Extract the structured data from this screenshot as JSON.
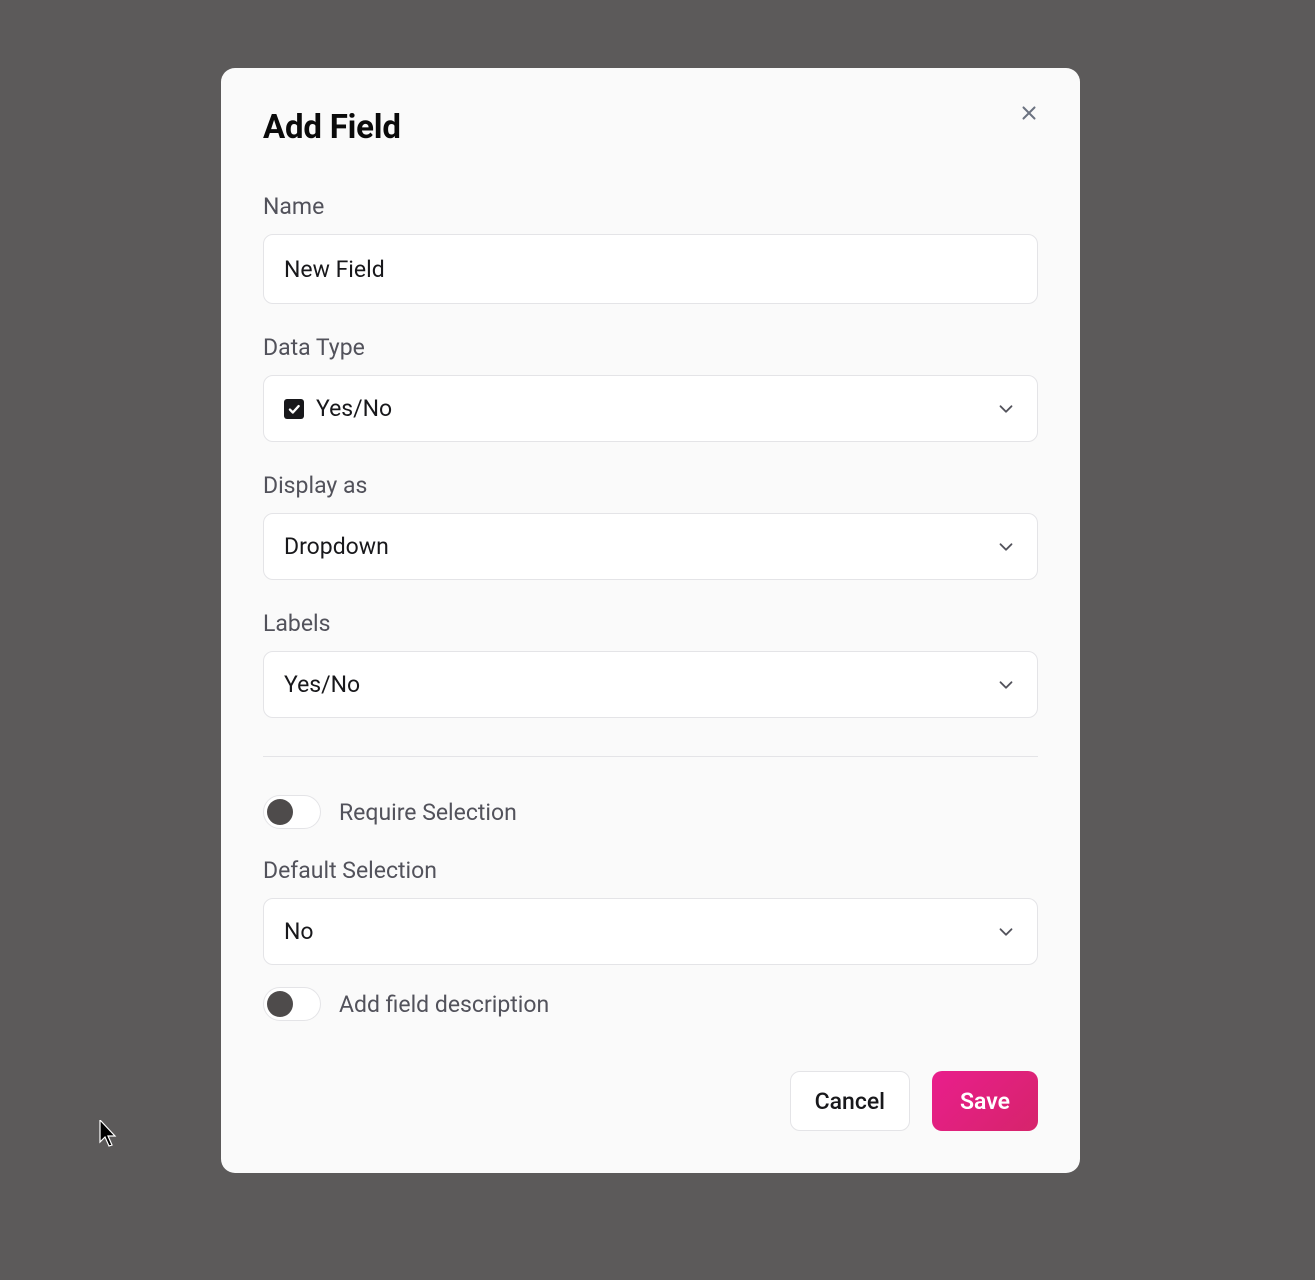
{
  "modal": {
    "title": "Add Field",
    "fields": {
      "name": {
        "label": "Name",
        "value": "New Field"
      },
      "dataType": {
        "label": "Data Type",
        "value": "Yes/No"
      },
      "displayAs": {
        "label": "Display as",
        "value": "Dropdown"
      },
      "labels": {
        "label": "Labels",
        "value": "Yes/No"
      },
      "requireSelection": {
        "label": "Require Selection"
      },
      "defaultSelection": {
        "label": "Default Selection",
        "value": "No"
      },
      "addFieldDescription": {
        "label": "Add field description"
      }
    },
    "buttons": {
      "cancel": "Cancel",
      "save": "Save"
    }
  }
}
